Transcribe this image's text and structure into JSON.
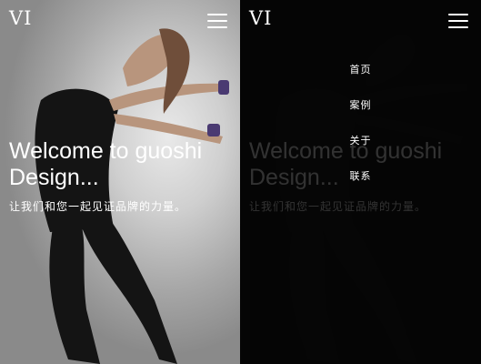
{
  "left": {
    "logo": "VI",
    "menu_icon": "hamburger-icon",
    "hero_title_line1": "Welcome to guoshi",
    "hero_title_line2": "Design...",
    "hero_subtitle": "让我们和您一起见证品牌的力量。"
  },
  "right": {
    "logo": "VI",
    "menu_icon": "hamburger-icon",
    "hero_title_line1": "Welcome to guoshi",
    "hero_title_line2": "Design...",
    "hero_subtitle": "让我们和您一起见证品牌的力量。",
    "nav": {
      "items": [
        {
          "label": "首页"
        },
        {
          "label": "案例"
        },
        {
          "label": "关于"
        },
        {
          "label": "联系"
        }
      ]
    }
  },
  "colors": {
    "text": "#ffffff",
    "overlay": "#000000"
  }
}
